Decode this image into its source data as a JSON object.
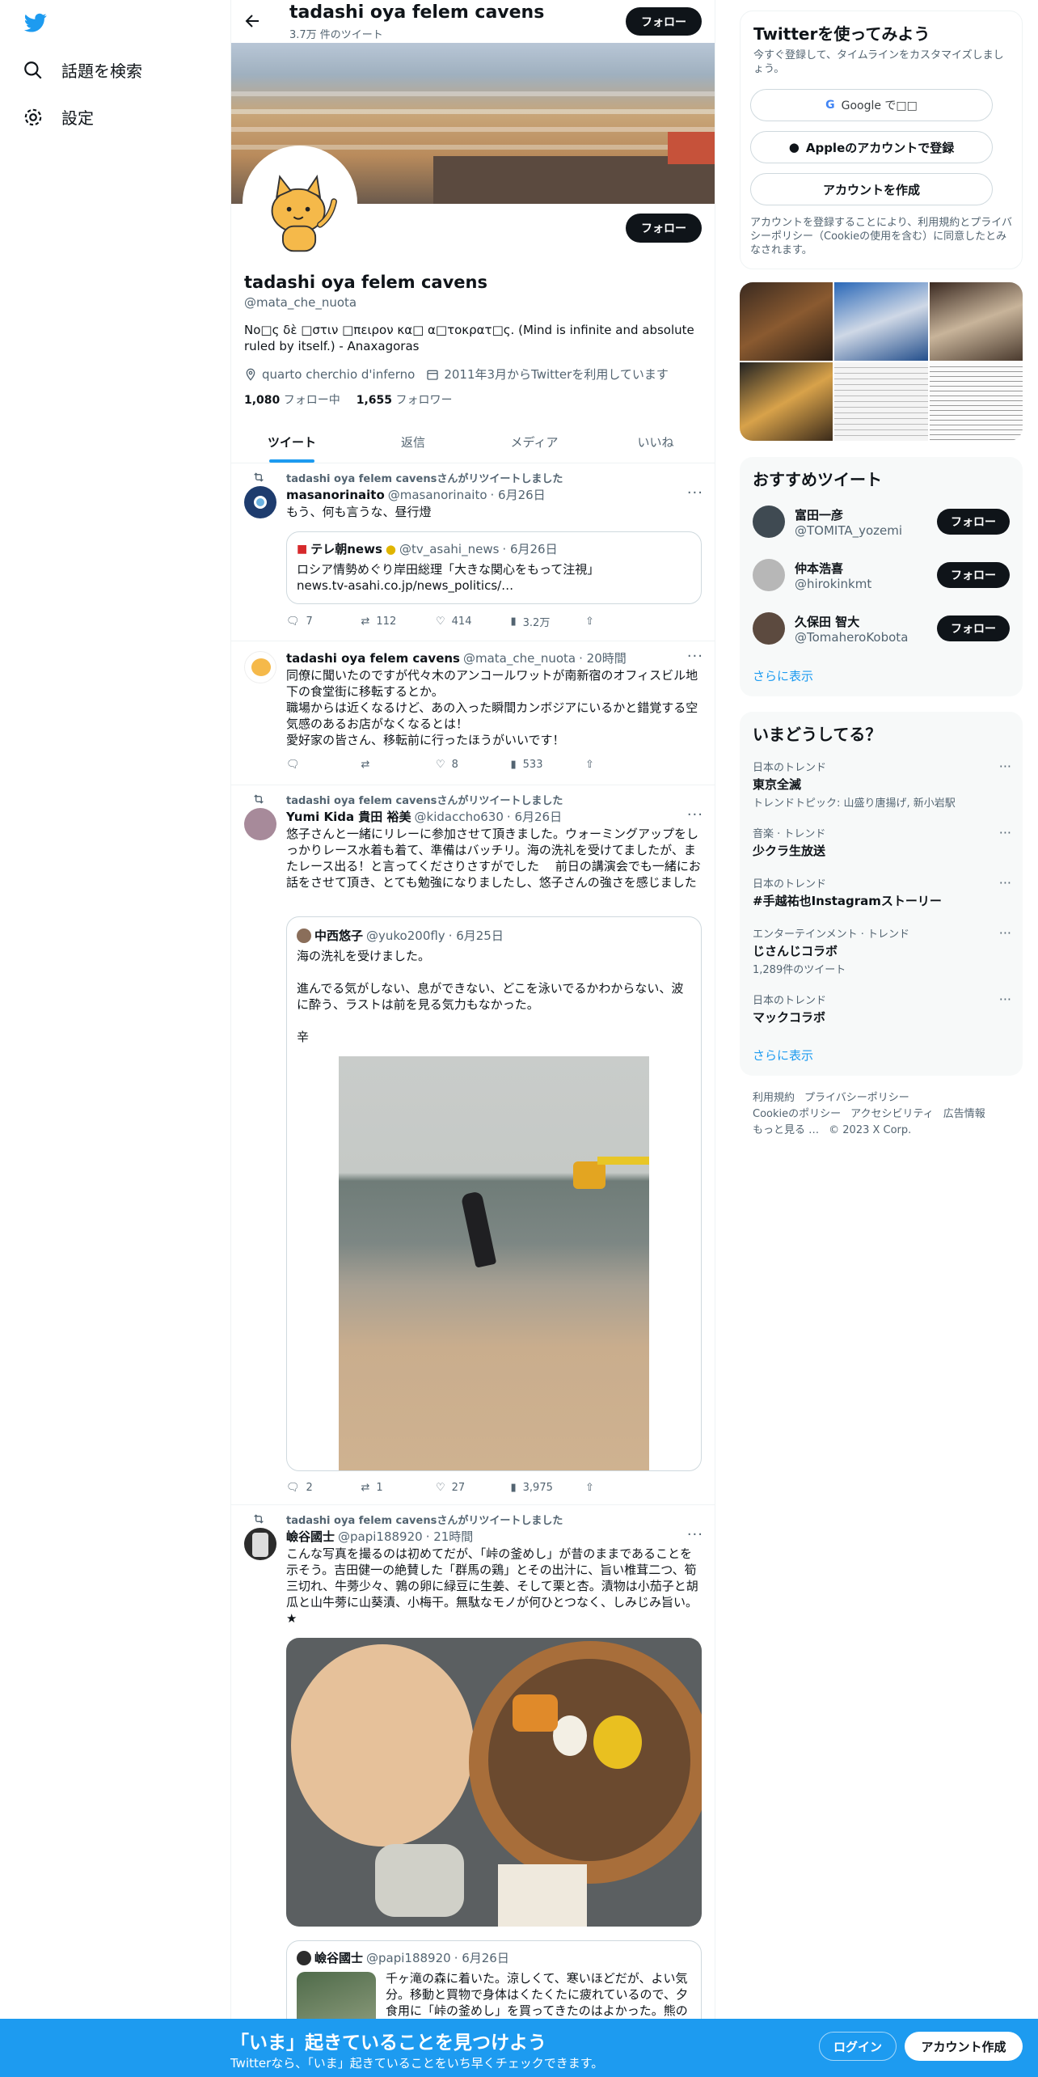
{
  "nav": {
    "logo": "twitter-bird",
    "items": [
      {
        "label": "話題を検索",
        "icon": "search-icon"
      },
      {
        "label": "設定",
        "icon": "gear-icon"
      }
    ]
  },
  "header": {
    "title": "tadashi oya felem cavens",
    "tweet_count": "3.7万 件のツイート",
    "follow_label": "フォロー"
  },
  "profile": {
    "name": "tadashi oya felem cavens",
    "handle": "@mata_che_nuota",
    "bio": "No□ς δὲ □στιν □πειρον κα□ α□τοκρατ□ς. (Mind is infinite and absolute ruled by itself.) - Anaxagoras",
    "location": "quarto cherchio d'inferno",
    "joined": "2011年3月からTwitterを利用しています",
    "following_count": "1,080",
    "following_label": "フォロー中",
    "followers_count": "1,655",
    "followers_label": "フォロワー",
    "follow_label": "フォロー"
  },
  "tabs": [
    {
      "label": "ツイート",
      "active": true
    },
    {
      "label": "返信",
      "active": false
    },
    {
      "label": "メディア",
      "active": false
    },
    {
      "label": "いいね",
      "active": false
    }
  ],
  "tweets": [
    {
      "retweet_by": "tadashi oya felem cavensさんがリツイートしました",
      "name": "masanorinaito",
      "handle": "@masanorinaito",
      "date": "· 6月26日",
      "text": "もう、何も言うな、昼行燈",
      "quote": {
        "name": "テレ朝news",
        "handle": "@tv_asahi_news",
        "date": "· 6月26日",
        "text": "ロシア情勢めぐり岸田総理「大きな関心をもって注視」\nnews.tv-asahi.co.jp/news_politics/…"
      },
      "replies": "7",
      "retweets": "112",
      "likes": "414",
      "views": "3.2万"
    },
    {
      "retweet_by": "",
      "name": "tadashi oya felem cavens",
      "handle": "@mata_che_nuota",
      "date": "· 20時間",
      "text": "同僚に聞いたのですが代々木のアンコールワットが南新宿のオフィスビル地下の食堂街に移転するとか。\n職場からは近くなるけど、あの入った瞬間カンボジアにいるかと錯覚する空気感のあるお店がなくなるとは！\n愛好家の皆さん、移転前に行ったほうがいいです！",
      "replies": "",
      "retweets": "",
      "likes": "8",
      "views": "533"
    },
    {
      "retweet_by": "tadashi oya felem cavensさんがリツイートしました",
      "name": "Yumi Kida 貴田 裕美",
      "handle": "@kidaccho630",
      "date": "· 6月26日",
      "text": "悠子さんと一緒にリレーに参加させて頂きました。ウォーミングアップをしっかりレース水着も着て、準備はバッチリ。海の洗礼を受けてましたが、またレース出る！と言ってくださりさすがでした　 前日の講演会でも一緒にお話をさせて頂き、とても勉強になりましたし、悠子さんの強さを感じました",
      "quote": {
        "name": "中西悠子",
        "handle": "@yuko200fly",
        "date": "· 6月25日",
        "text": "海の洗礼を受けました。\n\n進んでる気がしない、息ができない、どこを泳いでるかわからない、波に酔う、ラストは前を見る気力もなかった。\n\n辛"
      },
      "replies": "2",
      "retweets": "1",
      "likes": "27",
      "views": "3,975"
    },
    {
      "retweet_by": "tadashi oya felem cavensさんがリツイートしました",
      "name": "嶮谷國士",
      "handle": "@papi188920",
      "date": "· 21時間",
      "text": "こんな写真を撮るのは初めてだが、「峠の釜めし」が昔のままであることを示そう。吉田健一の絶賛した「群馬の鶏」とその出汁に、旨い椎茸二つ、筍三切れ、牛蒡少々、鶉の卵に緑豆に生姜、そして栗と杏。漬物は小茄子と胡瓜と山牛蒡に山葵漬、小梅干。無駄なモノが何ひとつなく、しみじみ旨い。★",
      "quote": {
        "name": "嶮谷國士",
        "handle": "@papi188920",
        "date": "· 6月26日",
        "text": "千ヶ滝の森に着いた。涼しくて、寒いほどだが、よい気分。移動と買物で身体はくたくたに疲れているので、夕食用に「峠の釜めし」を買ってきたのはよかった。熊の"
      }
    }
  ],
  "sidebar": {
    "signup": {
      "title": "Twitterを使ってみよう",
      "sub": "今すぐ登録して、タイムラインをカスタマイズしましょう。",
      "google": "Google で□□",
      "apple": "Appleのアカウントで登録",
      "create": "アカウントを作成",
      "terms": "アカウントを登録することにより、利用規約とプライバシーポリシー（Cookieの使用を含む）に同意したとみなされます。"
    },
    "recommend": {
      "title": "おすすめツイート",
      "users": [
        {
          "name": "富田一彦",
          "handle": "@TOMITA_yozemi",
          "button": "フォロー"
        },
        {
          "name": "仲本浩喜",
          "handle": "@hirokinkmt",
          "button": "フォロー"
        },
        {
          "name": "久保田 智大",
          "handle": "@TomaheroKobota",
          "button": "フォロー"
        }
      ],
      "more": "さらに表示"
    },
    "trends": {
      "title": "いまどうしてる？",
      "items": [
        {
          "context": "日本のトレンド",
          "name": "東京全滅",
          "extra": "トレンドトピック: 山盛り唐揚げ, 新小岩駅"
        },
        {
          "context": "音楽 · トレンド",
          "name": "少クラ生放送",
          "extra": ""
        },
        {
          "context": "日本のトレンド",
          "name": "#手越祐也Instagramストーリー",
          "extra": ""
        },
        {
          "context": "エンターテインメント · トレンド",
          "name": "じさんじコラボ",
          "extra": "1,289件のツイート"
        },
        {
          "context": "日本のトレンド",
          "name": "マックコラボ",
          "extra": ""
        }
      ],
      "more": "さらに表示"
    },
    "footer": {
      "line1": [
        "利用規約",
        "プライバシーポリシー"
      ],
      "line2": [
        "Cookieのポリシー",
        "アクセシビリティ",
        "広告情報"
      ],
      "line3": [
        "もっと見る …",
        "© 2023 X Corp."
      ]
    }
  },
  "bottombar": {
    "headline": "「いま」起きていることを見つけよう",
    "sub": "Twitterなら、「いま」起きていることをいち早くチェックできます。",
    "login": "ログイン",
    "signup": "アカウント作成"
  },
  "colors": {
    "accent": "#1d9bf0",
    "text": "#0f1419",
    "muted": "#536471"
  }
}
